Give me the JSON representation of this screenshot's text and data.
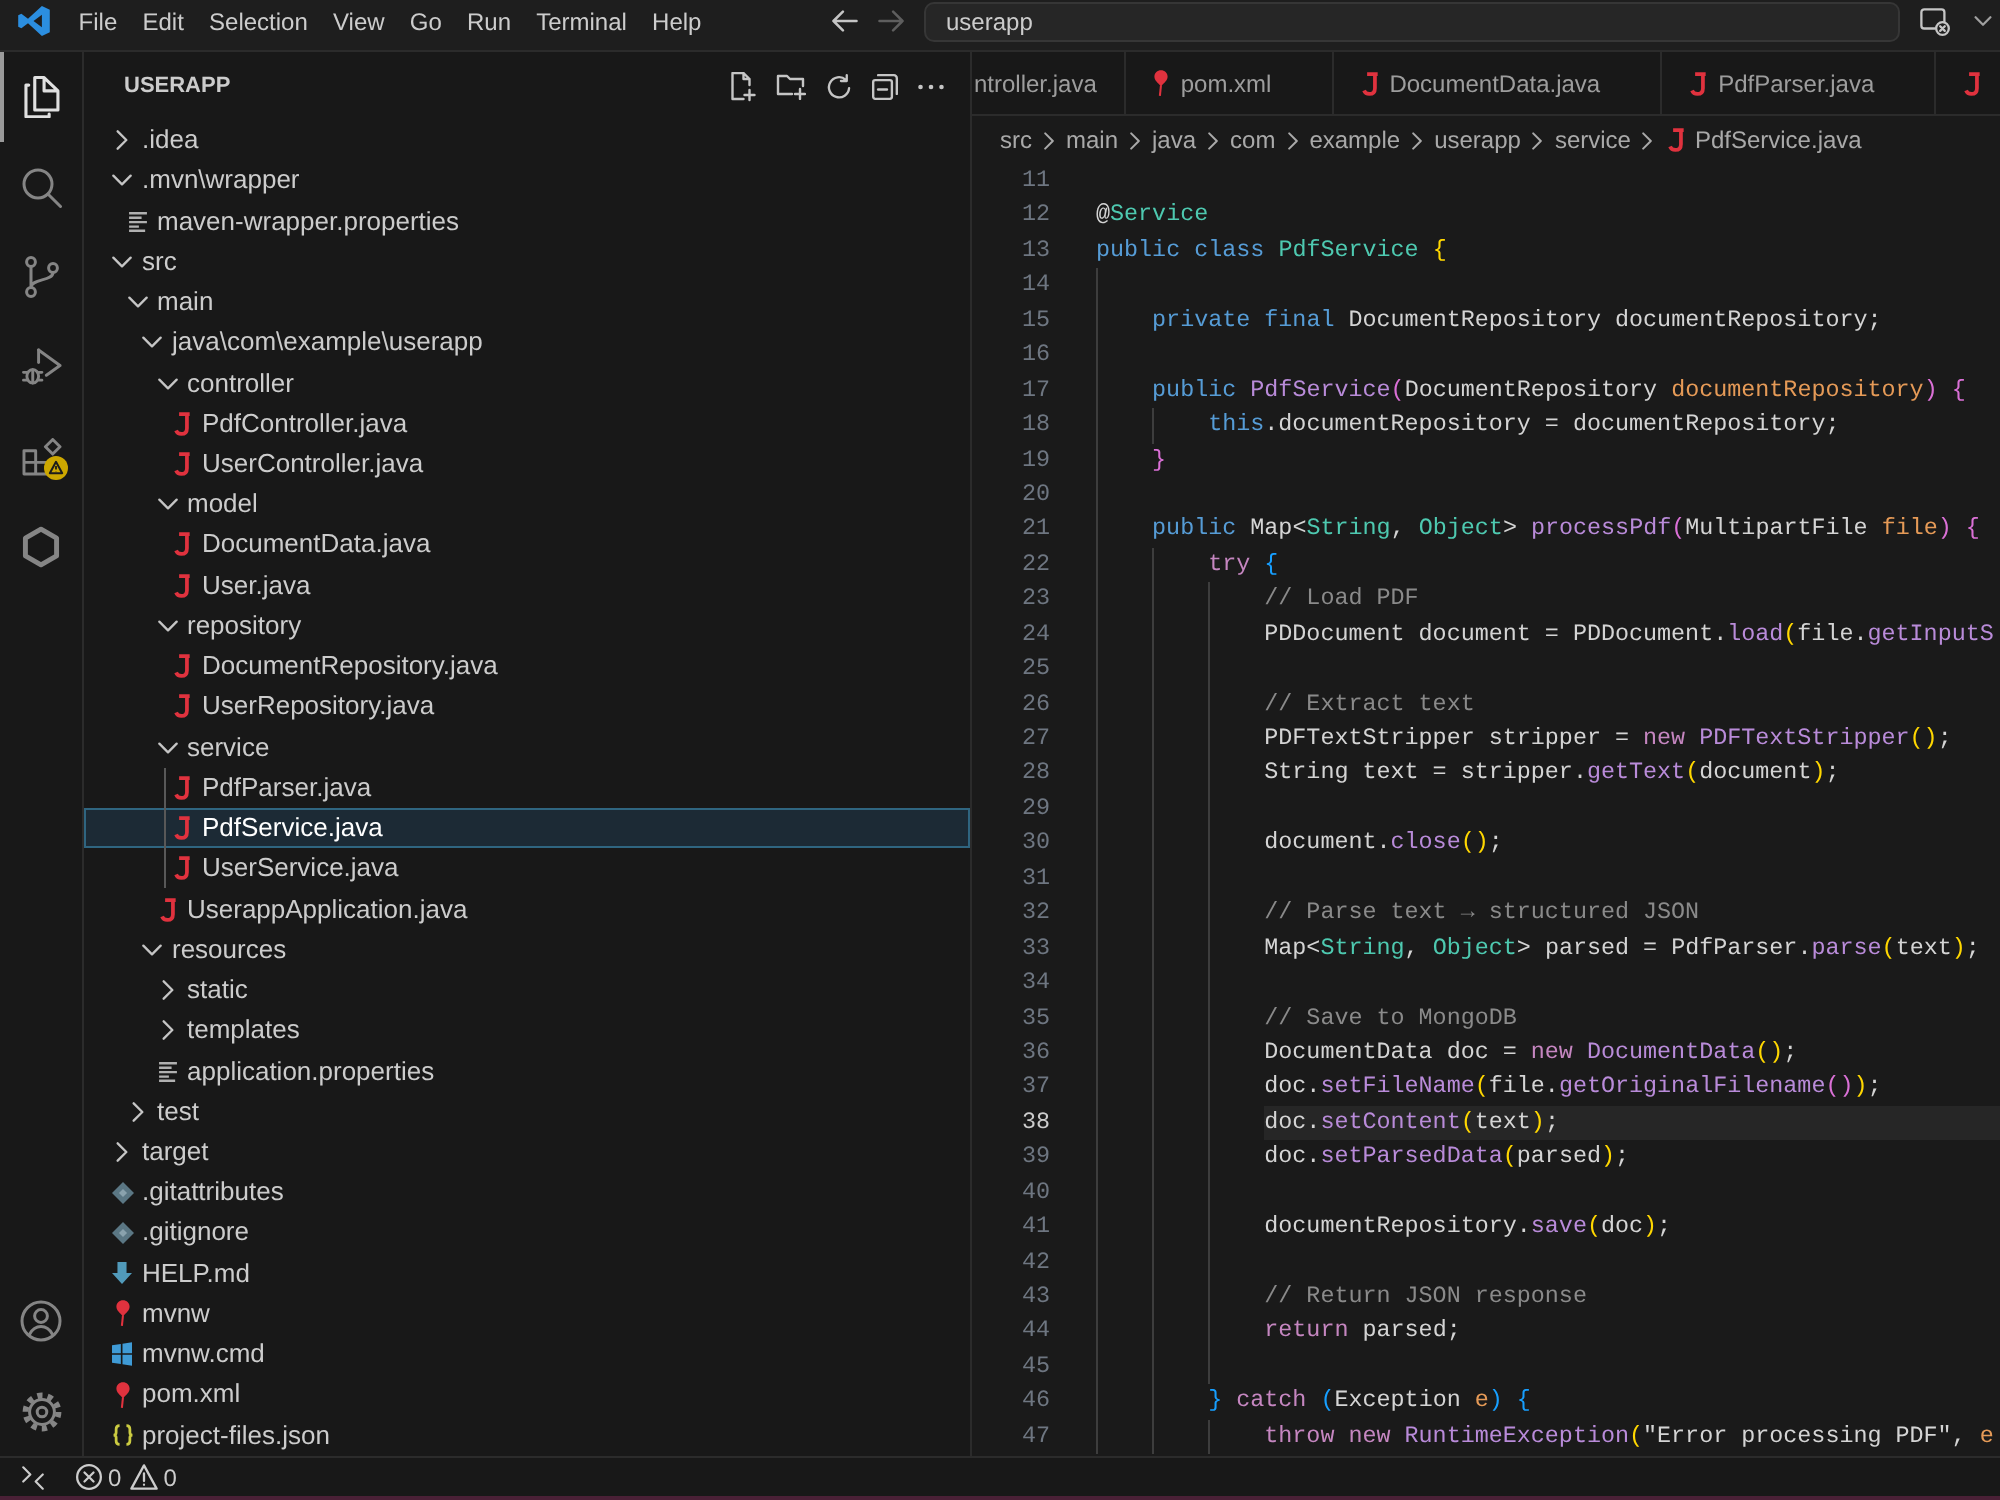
{
  "title_bar": {
    "menu": [
      "File",
      "Edit",
      "Selection",
      "View",
      "Go",
      "Run",
      "Terminal",
      "Help"
    ],
    "navigation": [
      {
        "kind": "back",
        "disabled": false
      },
      {
        "kind": "forward",
        "disabled": true
      }
    ],
    "command_center": {
      "label": "userapp"
    }
  },
  "activity_bar": {
    "items": [
      {
        "kind": "files",
        "selected": true,
        "warning": false
      },
      {
        "kind": "search",
        "selected": false,
        "warning": false
      },
      {
        "kind": "branch",
        "selected": false,
        "warning": false
      },
      {
        "kind": "debug",
        "selected": false,
        "warning": false
      },
      {
        "kind": "extensions",
        "selected": false,
        "warning": true
      },
      {
        "kind": "hexagon",
        "selected": false,
        "warning": false
      }
    ],
    "bottom": [
      {
        "kind": "account"
      },
      {
        "kind": "settings"
      }
    ]
  },
  "explorer": {
    "title": "USERAPP",
    "tree": [
      {
        "name": ".idea",
        "kind": "folder",
        "expanded": false,
        "selected": false
      },
      {
        "name": ".mvn\\wrapper",
        "kind": "folder",
        "expanded": true,
        "selected": false,
        "children": [
          {
            "name": "maven-wrapper.properties",
            "kind": "properties",
            "selected": false
          }
        ]
      },
      {
        "name": "src",
        "kind": "folder",
        "expanded": true,
        "selected": false,
        "children": [
          {
            "name": "main",
            "kind": "folder",
            "expanded": true,
            "selected": false,
            "children": [
              {
                "name": "java\\com\\example\\userapp",
                "kind": "folder",
                "expanded": true,
                "selected": false,
                "children": [
                  {
                    "name": "controller",
                    "kind": "folder",
                    "expanded": true,
                    "selected": false,
                    "children": [
                      {
                        "name": "PdfController.java",
                        "kind": "java",
                        "selected": false
                      },
                      {
                        "name": "UserController.java",
                        "kind": "java",
                        "selected": false
                      }
                    ]
                  },
                  {
                    "name": "model",
                    "kind": "folder",
                    "expanded": true,
                    "selected": false,
                    "children": [
                      {
                        "name": "DocumentData.java",
                        "kind": "java",
                        "selected": false
                      },
                      {
                        "name": "User.java",
                        "kind": "java",
                        "selected": false
                      }
                    ]
                  },
                  {
                    "name": "repository",
                    "kind": "folder",
                    "expanded": true,
                    "selected": false,
                    "children": [
                      {
                        "name": "DocumentRepository.java",
                        "kind": "java",
                        "selected": false
                      },
                      {
                        "name": "UserRepository.java",
                        "kind": "java",
                        "selected": false
                      }
                    ]
                  },
                  {
                    "name": "service",
                    "kind": "folder",
                    "expanded": true,
                    "selected": false,
                    "children": [
                      {
                        "name": "PdfParser.java",
                        "kind": "java",
                        "selected": false
                      },
                      {
                        "name": "PdfService.java",
                        "kind": "java",
                        "selected": true
                      },
                      {
                        "name": "UserService.java",
                        "kind": "java",
                        "selected": false
                      }
                    ]
                  },
                  {
                    "name": "UserappApplication.java",
                    "kind": "java",
                    "selected": false
                  }
                ]
              },
              {
                "name": "resources",
                "kind": "folder",
                "expanded": true,
                "selected": false,
                "children": [
                  {
                    "name": "static",
                    "kind": "folder",
                    "expanded": false,
                    "selected": false
                  },
                  {
                    "name": "templates",
                    "kind": "folder",
                    "expanded": false,
                    "selected": false
                  },
                  {
                    "name": "application.properties",
                    "kind": "properties",
                    "selected": false
                  }
                ]
              }
            ]
          },
          {
            "name": "test",
            "kind": "folder",
            "expanded": false,
            "selected": false
          }
        ]
      },
      {
        "name": "target",
        "kind": "folder",
        "expanded": false,
        "selected": false
      },
      {
        "name": ".gitattributes",
        "kind": "git",
        "selected": false
      },
      {
        "name": ".gitignore",
        "kind": "git",
        "selected": false
      },
      {
        "name": "HELP.md",
        "kind": "markdown",
        "selected": false
      },
      {
        "name": "mvnw",
        "kind": "maven",
        "selected": false
      },
      {
        "name": "mvnw.cmd",
        "kind": "cmd",
        "selected": false
      },
      {
        "name": "pom.xml",
        "kind": "maven",
        "selected": false
      },
      {
        "name": "project-files.json",
        "kind": "json",
        "selected": false
      }
    ]
  },
  "editor": {
    "tabs": [
      {
        "label": "ntroller.java",
        "selected": false
      },
      {
        "label": "pom.xml",
        "kind": "maven",
        "selected": false
      },
      {
        "label": "DocumentData.java",
        "kind": "java",
        "selected": false
      },
      {
        "label": "PdfParser.java",
        "kind": "java",
        "selected": false
      },
      {
        "kind": "java",
        "selected": false
      }
    ],
    "breadcrumb": {
      "path": [
        "src",
        "main",
        "java",
        "com",
        "example",
        "userapp",
        "service"
      ],
      "file": {
        "kind": "java",
        "name": "PdfService.java"
      }
    },
    "lines": [
      {
        "number": "11",
        "current": false
      },
      {
        "number": "12",
        "current": false,
        "tokens": [
          {
            "text": "@",
            "kind": "plain"
          },
          {
            "text": "Service",
            "kind": "type"
          }
        ]
      },
      {
        "number": "13",
        "current": false,
        "tokens": [
          {
            "text": "public class ",
            "kind": "kw"
          },
          {
            "text": "PdfService ",
            "kind": "type"
          },
          {
            "text": "{",
            "kind": "b1"
          }
        ],
        "children": [
          {
            "number": "14",
            "current": false
          },
          {
            "number": "15",
            "current": false,
            "tokens": [
              {
                "text": "private final ",
                "kind": "kw"
              },
              {
                "text": "DocumentRepository documentRepository;",
                "kind": "plain"
              }
            ]
          },
          {
            "number": "16",
            "current": false
          },
          {
            "number": "17",
            "current": false,
            "tokens": [
              {
                "text": "public ",
                "kind": "kw"
              },
              {
                "text": "PdfService",
                "kind": "fn"
              },
              {
                "text": "(",
                "kind": "b2"
              },
              {
                "text": "DocumentRepository ",
                "kind": "plain"
              },
              {
                "text": "documentRepository",
                "kind": "param"
              },
              {
                "text": ") {",
                "kind": "b2"
              }
            ],
            "children": [
              {
                "number": "18",
                "current": false,
                "tokens": [
                  {
                    "text": "this",
                    "kind": "kw"
                  },
                  {
                    "text": ".documentRepository = documentRepository;",
                    "kind": "plain"
                  }
                ]
              }
            ]
          },
          {
            "number": "19",
            "current": false,
            "tokens": [
              {
                "text": "}",
                "kind": "b2"
              }
            ]
          },
          {
            "number": "20",
            "current": false
          },
          {
            "number": "21",
            "current": false,
            "tokens": [
              {
                "text": "public ",
                "kind": "kw"
              },
              {
                "text": "Map<",
                "kind": "plain"
              },
              {
                "text": "String",
                "kind": "type"
              },
              {
                "text": ", ",
                "kind": "plain"
              },
              {
                "text": "Object",
                "kind": "type"
              },
              {
                "text": "> ",
                "kind": "plain"
              },
              {
                "text": "processPdf",
                "kind": "fn"
              },
              {
                "text": "(",
                "kind": "b2"
              },
              {
                "text": "MultipartFile ",
                "kind": "plain"
              },
              {
                "text": "file",
                "kind": "param"
              },
              {
                "text": ") {",
                "kind": "b2"
              }
            ],
            "children": [
              {
                "number": "22",
                "current": false,
                "tokens": [
                  {
                    "text": "try ",
                    "kind": "ctrl"
                  },
                  {
                    "text": "{",
                    "kind": "b3"
                  }
                ],
                "children": [
                  {
                    "number": "23",
                    "current": false,
                    "tokens": [
                      {
                        "text": "// Load PDF",
                        "kind": "comment"
                      }
                    ]
                  },
                  {
                    "number": "24",
                    "current": false,
                    "tokens": [
                      {
                        "text": "PDDocument document = PDDocument.",
                        "kind": "plain"
                      },
                      {
                        "text": "load",
                        "kind": "fn"
                      },
                      {
                        "text": "(",
                        "kind": "b1"
                      },
                      {
                        "text": "file.",
                        "kind": "plain"
                      },
                      {
                        "text": "getInputS",
                        "kind": "fn"
                      }
                    ]
                  },
                  {
                    "number": "25",
                    "current": false
                  },
                  {
                    "number": "26",
                    "current": false,
                    "tokens": [
                      {
                        "text": "// Extract text",
                        "kind": "comment"
                      }
                    ]
                  },
                  {
                    "number": "27",
                    "current": false,
                    "tokens": [
                      {
                        "text": "PDFTextStripper stripper = ",
                        "kind": "plain"
                      },
                      {
                        "text": "new ",
                        "kind": "ctrl"
                      },
                      {
                        "text": "PDFTextStripper",
                        "kind": "fn"
                      },
                      {
                        "text": "()",
                        "kind": "b1"
                      },
                      {
                        "text": ";",
                        "kind": "plain"
                      }
                    ]
                  },
                  {
                    "number": "28",
                    "current": false,
                    "tokens": [
                      {
                        "text": "String text = stripper.",
                        "kind": "plain"
                      },
                      {
                        "text": "getText",
                        "kind": "fn"
                      },
                      {
                        "text": "(",
                        "kind": "b1"
                      },
                      {
                        "text": "document",
                        "kind": "plain"
                      },
                      {
                        "text": ")",
                        "kind": "b1"
                      },
                      {
                        "text": ";",
                        "kind": "plain"
                      }
                    ]
                  },
                  {
                    "number": "29",
                    "current": false
                  },
                  {
                    "number": "30",
                    "current": false,
                    "tokens": [
                      {
                        "text": "document.",
                        "kind": "plain"
                      },
                      {
                        "text": "close",
                        "kind": "fn"
                      },
                      {
                        "text": "()",
                        "kind": "b1"
                      },
                      {
                        "text": ";",
                        "kind": "plain"
                      }
                    ]
                  },
                  {
                    "number": "31",
                    "current": false
                  },
                  {
                    "number": "32",
                    "current": false,
                    "tokens": [
                      {
                        "text": "// Parse text → structured JSON",
                        "kind": "comment"
                      }
                    ]
                  },
                  {
                    "number": "33",
                    "current": false,
                    "tokens": [
                      {
                        "text": "Map<",
                        "kind": "plain"
                      },
                      {
                        "text": "String",
                        "kind": "type"
                      },
                      {
                        "text": ", ",
                        "kind": "plain"
                      },
                      {
                        "text": "Object",
                        "kind": "type"
                      },
                      {
                        "text": "> parsed = PdfParser.",
                        "kind": "plain"
                      },
                      {
                        "text": "parse",
                        "kind": "fn"
                      },
                      {
                        "text": "(",
                        "kind": "b1"
                      },
                      {
                        "text": "text",
                        "kind": "plain"
                      },
                      {
                        "text": ")",
                        "kind": "b1"
                      },
                      {
                        "text": ";",
                        "kind": "plain"
                      }
                    ]
                  },
                  {
                    "number": "34",
                    "current": false
                  },
                  {
                    "number": "35",
                    "current": false,
                    "tokens": [
                      {
                        "text": "// Save to MongoDB",
                        "kind": "comment"
                      }
                    ]
                  },
                  {
                    "number": "36",
                    "current": false,
                    "tokens": [
                      {
                        "text": "DocumentData doc = ",
                        "kind": "plain"
                      },
                      {
                        "text": "new ",
                        "kind": "ctrl"
                      },
                      {
                        "text": "DocumentData",
                        "kind": "fn"
                      },
                      {
                        "text": "()",
                        "kind": "b1"
                      },
                      {
                        "text": ";",
                        "kind": "plain"
                      }
                    ]
                  },
                  {
                    "number": "37",
                    "current": false,
                    "tokens": [
                      {
                        "text": "doc.",
                        "kind": "plain"
                      },
                      {
                        "text": "setFileName",
                        "kind": "fn"
                      },
                      {
                        "text": "(",
                        "kind": "b1"
                      },
                      {
                        "text": "file.",
                        "kind": "plain"
                      },
                      {
                        "text": "getOriginalFilename",
                        "kind": "fn"
                      },
                      {
                        "text": "()",
                        "kind": "b2"
                      },
                      {
                        "text": ")",
                        "kind": "b1"
                      },
                      {
                        "text": ";",
                        "kind": "plain"
                      }
                    ]
                  },
                  {
                    "number": "38",
                    "current": true,
                    "tokens": [
                      {
                        "text": "doc.",
                        "kind": "plain"
                      },
                      {
                        "text": "setContent",
                        "kind": "fn"
                      },
                      {
                        "text": "(",
                        "kind": "b1"
                      },
                      {
                        "text": "text",
                        "kind": "plain"
                      },
                      {
                        "text": ")",
                        "kind": "b1"
                      },
                      {
                        "text": ";",
                        "kind": "plain"
                      }
                    ]
                  },
                  {
                    "number": "39",
                    "current": false,
                    "tokens": [
                      {
                        "text": "doc.",
                        "kind": "plain"
                      },
                      {
                        "text": "setParsedData",
                        "kind": "fn"
                      },
                      {
                        "text": "(",
                        "kind": "b1"
                      },
                      {
                        "text": "parsed",
                        "kind": "plain"
                      },
                      {
                        "text": ")",
                        "kind": "b1"
                      },
                      {
                        "text": ";",
                        "kind": "plain"
                      }
                    ]
                  },
                  {
                    "number": "40",
                    "current": false
                  },
                  {
                    "number": "41",
                    "current": false,
                    "tokens": [
                      {
                        "text": "documentRepository.",
                        "kind": "plain"
                      },
                      {
                        "text": "save",
                        "kind": "fn"
                      },
                      {
                        "text": "(",
                        "kind": "b1"
                      },
                      {
                        "text": "doc",
                        "kind": "plain"
                      },
                      {
                        "text": ")",
                        "kind": "b1"
                      },
                      {
                        "text": ";",
                        "kind": "plain"
                      }
                    ]
                  },
                  {
                    "number": "42",
                    "current": false
                  },
                  {
                    "number": "43",
                    "current": false,
                    "tokens": [
                      {
                        "text": "// Return JSON response",
                        "kind": "comment"
                      }
                    ]
                  },
                  {
                    "number": "44",
                    "current": false,
                    "tokens": [
                      {
                        "text": "return ",
                        "kind": "ctrl"
                      },
                      {
                        "text": "parsed;",
                        "kind": "plain"
                      }
                    ]
                  },
                  {
                    "number": "45",
                    "current": false
                  }
                ]
              },
              {
                "number": "46",
                "current": false,
                "tokens": [
                  {
                    "text": "} ",
                    "kind": "b3"
                  },
                  {
                    "text": "catch ",
                    "kind": "ctrl"
                  },
                  {
                    "text": "(",
                    "kind": "b3"
                  },
                  {
                    "text": "Exception ",
                    "kind": "plain"
                  },
                  {
                    "text": "e",
                    "kind": "param"
                  },
                  {
                    "text": ") {",
                    "kind": "b3"
                  }
                ],
                "children": [
                  {
                    "number": "47",
                    "current": false,
                    "tokens": [
                      {
                        "text": "throw new ",
                        "kind": "ctrl"
                      },
                      {
                        "text": "RuntimeException",
                        "kind": "fn"
                      },
                      {
                        "text": "(",
                        "kind": "b1"
                      },
                      {
                        "text": "\"Error processing PDF\", ",
                        "kind": "plain"
                      },
                      {
                        "text": "e",
                        "kind": "param"
                      }
                    ]
                  }
                ]
              }
            ]
          }
        ]
      }
    ]
  },
  "status_bar": {
    "errors": "0",
    "warnings": "0"
  }
}
